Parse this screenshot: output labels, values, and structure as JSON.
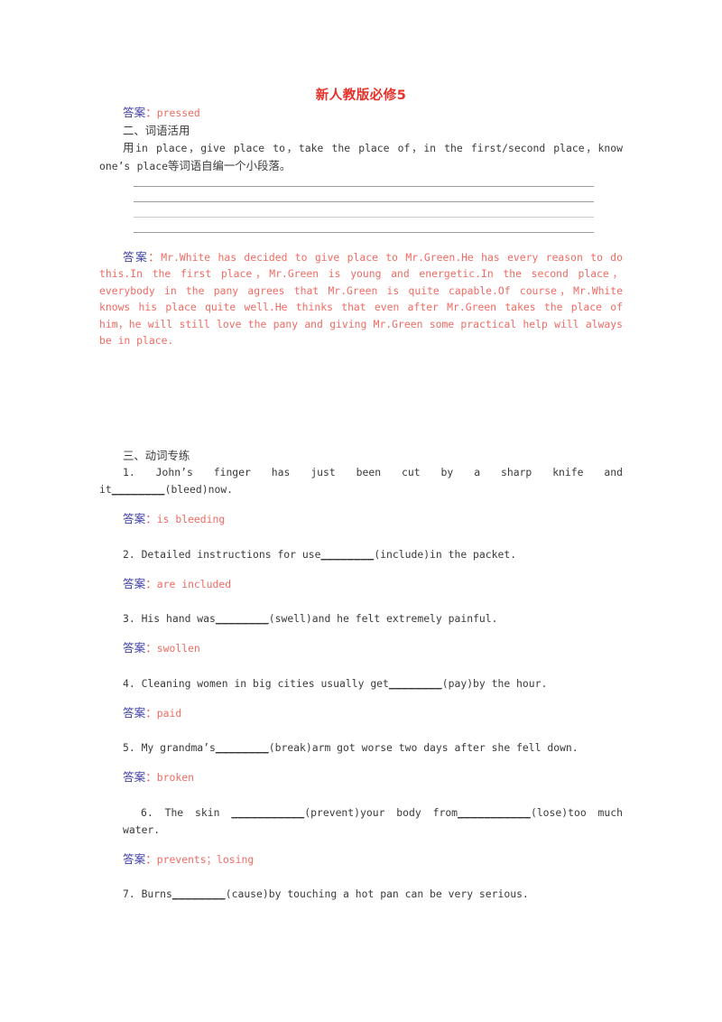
{
  "document": {
    "title": "新人教版必修5"
  },
  "first_answer": {
    "label": "答案",
    "colon": "：",
    "text": "pressed"
  },
  "section_two": {
    "heading": "二、词语活用",
    "prompt_prefix": "用",
    "prompt_body": "in place，give place to，take the place of，in the first/second place，know one’s place",
    "prompt_suffix": "等词语自编一个小段落。",
    "blank_line_count": 4,
    "answer": {
      "label": "答案",
      "colon": "：",
      "text": "Mr.White has decided to give place to Mr.Green.He has every reason to do this.In the first place，Mr.Green is young and energetic.In the second place，everybody in the pany agrees that Mr.Green is quite capable.Of course，Mr.White knows his place quite well.He thinks that even after Mr.Green takes the place of him，he will still love the pany and giving Mr.Green some practical help will always be in place."
    }
  },
  "section_three": {
    "heading": "三、动词专练",
    "questions": [
      {
        "number": "1.",
        "text_before": "John’s finger has just been cut by a sharp knife and it",
        "blank": "________",
        "text_after": "(bleed)now.",
        "answer": {
          "label": "答案",
          "colon": "：",
          "text": "is bleeding"
        }
      },
      {
        "number": "2.",
        "text_before": "Detailed instructions for use",
        "blank": "________",
        "text_after": "(include)in the packet.",
        "answer": {
          "label": "答案",
          "colon": "：",
          "text": "are included"
        }
      },
      {
        "number": "3.",
        "text_before": "His hand was",
        "blank": "________",
        "text_after": "(swell)and he felt extremely painful.",
        "answer": {
          "label": "答案",
          "colon": "：",
          "text": "swollen"
        }
      },
      {
        "number": "4.",
        "text_before": "Cleaning women in big cities usually get",
        "blank": "________",
        "text_after": "(pay)by the hour.",
        "answer": {
          "label": "答案",
          "colon": "：",
          "text": "paid"
        }
      },
      {
        "number": "5.",
        "text_before": "My grandma’s",
        "blank": "________",
        "text_after": "(break)arm got worse two days after she fell down.",
        "answer": {
          "label": "答案",
          "colon": "：",
          "text": "broken"
        }
      },
      {
        "number": "6.",
        "text_before": "The skin ",
        "blank": "___________",
        "text_mid": "(prevent)your body from",
        "blank2": "___________",
        "text_after": "(lose)too much water.",
        "answer": {
          "label": "答案",
          "colon": "：",
          "text": "prevents；losing"
        }
      },
      {
        "number": "7.",
        "text_before": "Burns",
        "blank": "________",
        "text_after": "(cause)by touching a hot pan can be very serious.",
        "answer": null
      }
    ]
  }
}
